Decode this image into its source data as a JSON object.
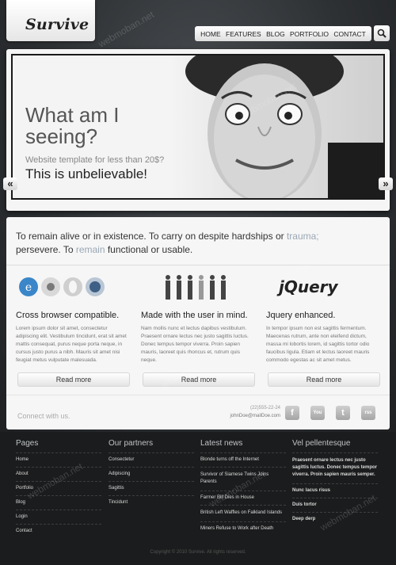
{
  "header": {
    "logo": "Survive",
    "nav": [
      "HOME",
      "FEATURES",
      "BLOG",
      "PORTFOLIO",
      "CONTACT"
    ],
    "search_icon": "magnifier"
  },
  "slider": {
    "title": "What am I seeing?",
    "subtitle": "Website template for less than 20$?",
    "tagline": "This is unbelievable!",
    "prev": "«",
    "next": "»"
  },
  "intro": {
    "part1": "To remain alive or in existence. To carry on despite hardships or ",
    "hl1": "trauma;",
    "part2": " persevere. To ",
    "hl2": "remain",
    "part3": " functional or usable."
  },
  "columns": [
    {
      "title": "Cross browser compatible.",
      "text": "Lorem ipsum dolor sit amet, consectetur adipiscing elit. Vestibulum tincidunt, erat sit amet mattis consequat, purus neque porta neque, in cursus justo purus a nibh. Mauris sit amet nisi feugiat metus vulputate malesuada.",
      "button": "Read more"
    },
    {
      "title": "Made with the user in mind.",
      "text": "Nam mollis nunc et lectus dapibus vestibulum. Praesent ornare lectus nec justo sagittis luctus. Donec tempus tempor viverra. Proin sapien mauris, laoreet quis rhoncus et, rutrum quis neque.",
      "button": "Read more"
    },
    {
      "title": "Jquery enhanced.",
      "text": "In tempor ipsum non est sagittis fermentum. Maecenas rutrum, ante non eleifend dictum, massa mi lobortis lorem, id sagittis tortor odio faucibus ligula. Etiam et lectus laoreet mauris commodo egestas ac sit amet metus.",
      "button": "Read more"
    }
  ],
  "jquery_logo": "jQuery",
  "contact": {
    "connect": "Connect with us.",
    "phone": "(22)555-22-24",
    "email": "johnDoe@mailDoe.com"
  },
  "social": [
    "f",
    "You",
    "t",
    "rss"
  ],
  "footer": {
    "pages": {
      "title": "Pages",
      "items": [
        "Home",
        "About",
        "Portfolio",
        "Blog",
        "Login",
        "Contact"
      ]
    },
    "partners": {
      "title": "Our partners",
      "items": [
        "Consectetur",
        "Adipiscing",
        "Sagittis",
        "Tincidunt"
      ]
    },
    "news": {
      "title": "Latest news",
      "items": [
        "Blonde turns off the Internet",
        "Survivor of Siamese Twins Joins Parents",
        "Farmer Bill Dies in House",
        "British Left Waffles on Falkland Islands",
        "Miners Refuse to Work after Death"
      ]
    },
    "misc": {
      "title": "Vel pellentesque",
      "items": [
        "Praesent ornare lectus nec justo sagittis luctus. Donec tempus tempor viverra. Proin sapien mauris semper.",
        "Nunc lacus risus",
        "Duis tortor",
        "Deep derp"
      ]
    },
    "copyright": "Copyright © 2010 Survive. All rights reserved."
  },
  "watermark": "webmoban.net"
}
